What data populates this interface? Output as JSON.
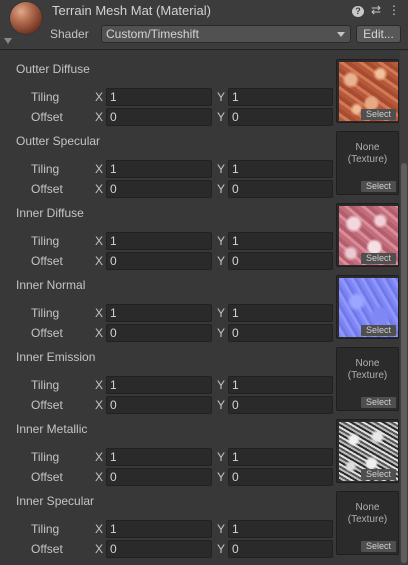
{
  "header": {
    "title": "Terrain Mesh Mat (Material)",
    "shader_label": "Shader",
    "shader_value": "Custom/Timeshift",
    "edit_label": "Edit...",
    "icons": [
      "help-icon",
      "preset-icon",
      "more-menu-icon"
    ]
  },
  "labels": {
    "tiling": "Tiling",
    "offset": "Offset",
    "x": "X",
    "y": "Y",
    "select": "Select",
    "none_line1": "None",
    "none_line2": "(Texture)"
  },
  "sections": [
    {
      "title": "Outter Diffuse",
      "tiling_x": "1",
      "tiling_y": "1",
      "offset_x": "0",
      "offset_y": "0",
      "texture": "outter-diffuse"
    },
    {
      "title": "Outter Specular",
      "tiling_x": "1",
      "tiling_y": "1",
      "offset_x": "0",
      "offset_y": "0",
      "texture": "none"
    },
    {
      "title": "Inner Diffuse",
      "tiling_x": "1",
      "tiling_y": "1",
      "offset_x": "0",
      "offset_y": "0",
      "texture": "inner-diffuse"
    },
    {
      "title": "Inner Normal",
      "tiling_x": "1",
      "tiling_y": "1",
      "offset_x": "0",
      "offset_y": "0",
      "texture": "inner-normal"
    },
    {
      "title": "Inner Emission",
      "tiling_x": "1",
      "tiling_y": "1",
      "offset_x": "0",
      "offset_y": "0",
      "texture": "none"
    },
    {
      "title": "Inner Metallic",
      "tiling_x": "1",
      "tiling_y": "1",
      "offset_x": "0",
      "offset_y": "0",
      "texture": "inner-metallic"
    },
    {
      "title": "Inner Specular",
      "tiling_x": "1",
      "tiling_y": "1",
      "offset_x": "0",
      "offset_y": "0",
      "texture": "none"
    }
  ]
}
